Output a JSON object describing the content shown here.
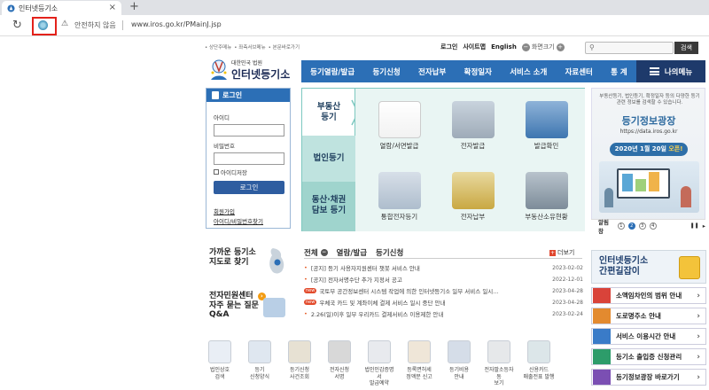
{
  "browser": {
    "tab_title": "인터넷등기소",
    "tab_close": "×",
    "new_tab": "+",
    "reload": "↻",
    "warning": "⚠",
    "security": "안전하지 않음",
    "url": "www.iros.go.kr/PMainJ.jsp"
  },
  "header": {
    "util_links": [
      "• 상단주메뉴",
      "• 좌측서브메뉴",
      "• 본문바로가기"
    ],
    "login": "로그인",
    "sitemap": "사이트맵",
    "english": "English",
    "zoom_label": "화면크기",
    "zoom_minus": "−",
    "zoom_plus": "+",
    "search_icon": "⚲",
    "search_button": "검색",
    "logo_sub": "대한민국 법원",
    "logo_main": "인터넷등기소"
  },
  "gnb": {
    "items": [
      "등기열람/발급",
      "등기신청",
      "전자납부",
      "확정일자",
      "서비스 소개",
      "자료센터",
      "통 계"
    ],
    "my_menu": "나의메뉴"
  },
  "login_box": {
    "title": "로그인",
    "id_label": "아이디",
    "pw_label": "비밀번호",
    "save_id": "아이디저장",
    "button": "로그인",
    "join": "회원가입",
    "find": "아이디/비밀번호찾기"
  },
  "registry": {
    "categories": [
      "부동산\n등기",
      "법인등기",
      "동산·채권\n담보 등기"
    ],
    "items": [
      "열람/서면발급",
      "전자발급",
      "발급확인",
      "통합전자등기",
      "전자납부",
      "부동산소유현황"
    ]
  },
  "banner": {
    "desc": "부동산등기, 법인등기, 확정일자 등의 다양한 등기관련 정보를 검색할 수 있습니다.",
    "title": "등기정보광장",
    "url": "https://data.iros.go.kr",
    "date": "2020년 1월 20일",
    "open": "오픈!",
    "ctl_label": "알림창",
    "pages": [
      "1",
      "2",
      "3",
      "4"
    ],
    "pause": "❚❚",
    "next": "▸"
  },
  "left_lower": {
    "near_line1": "가까운 등기소",
    "near_line2": "지도로 찾기",
    "civil": "전자민원센터",
    "civil_arrow": "›",
    "faq_line1": "자주 묻는 질문",
    "faq_line2": "Q&A"
  },
  "news": {
    "tabs": [
      "전체",
      "열람/발급",
      "등기신청"
    ],
    "tab_dd": "−",
    "more": "더보기",
    "more_icon": "+",
    "bullet": "•",
    "new_badge": "new",
    "items": [
      {
        "text": "[공지] 등기 사용자지원센터 챗봇 서비스 안내",
        "date": "2023-02-02",
        "isnew": false
      },
      {
        "text": "[공지] 전자서명수단 추가 지정서 공고",
        "date": "2022-12-01",
        "isnew": false
      },
      {
        "text": "국토부 공간정보센터 시스템 작업에 의한 인터넷등기소 일부 서비스 일시...",
        "date": "2023-04-28",
        "isnew": true
      },
      {
        "text": "우체국 카드 및 계좌이체 결제 서비스 일시 중단 안내",
        "date": "2023-04-28",
        "isnew": true
      },
      {
        "text": "2.26(일)이후 일부 우리카드 결제서비스 이용제한 안내",
        "date": "2023-02-24",
        "isnew": false
      }
    ]
  },
  "right_lower": {
    "gansim_line1": "인터넷등기소",
    "gansim_line2": "간편길잡이",
    "gansim_arrow": "›",
    "buttons": [
      "소액임차인의 범위 안내",
      "도로명주소 안내",
      "서비스 이용시간 안내",
      "등기소 출입증 신청관리",
      "등기정보광장 바로가기"
    ],
    "arrow": "›"
  },
  "bottom_icons": [
    {
      "l1": "법인상호",
      "l2": "검색",
      "color": "#e9eef5"
    },
    {
      "l1": "등기",
      "l2": "신청양식",
      "color": "#dfe7f0"
    },
    {
      "l1": "등기신청",
      "l2": "사건조회",
      "color": "#e7e1d3"
    },
    {
      "l1": "전자신청",
      "l2": "서명",
      "color": "#d8d8d8"
    },
    {
      "l1": "법인인감증명서",
      "l2": "발급예약",
      "color": "#e8eaee"
    },
    {
      "l1": "등록면허세",
      "l2": "정액분 신고",
      "color": "#efe6d8"
    },
    {
      "l1": "등기비용",
      "l2": "안내",
      "color": "#d5dde8"
    },
    {
      "l1": "전자팔소등자동",
      "l2": "보기",
      "color": "#e6e8ea"
    },
    {
      "l1": "신용카드",
      "l2": "매출전표 발행",
      "color": "#dce6e9"
    }
  ]
}
